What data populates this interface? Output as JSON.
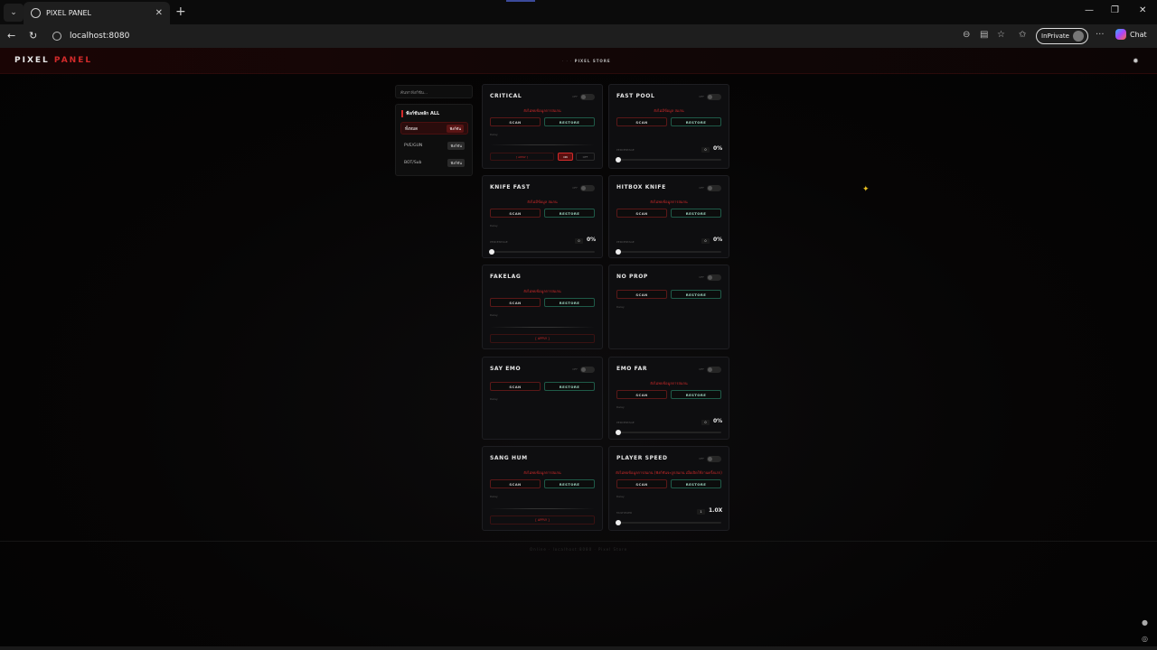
{
  "browser": {
    "tab_title": "PIXEL PANEL",
    "url": "localhost:8080",
    "inprivate_label": "InPrivate",
    "chat_label": "Chat"
  },
  "app": {
    "logo_a": "PIXEL",
    "logo_b": "PANEL",
    "breadcrumb_a": "· · ·",
    "breadcrumb_b": "PIXEL STORE",
    "search_placeholder": "ค้นหาฟังก์ชัน...",
    "footer": "Online   ·   localhost:8080   ·   Pixel Store"
  },
  "sidebar": {
    "title": "ฟังก์ชันหลัก ALL",
    "items": [
      {
        "label": "ทั้งหมด",
        "badge": "ฟังก์ชัน",
        "active": true
      },
      {
        "label": "PVE/GUN",
        "badge": "ฟังก์ชัน",
        "active": false
      },
      {
        "label": "BOT/Sub",
        "badge": "ฟังก์ชัน",
        "active": false
      }
    ]
  },
  "cards": [
    {
      "title": "CRITICAL",
      "status": "ยังไม่พบข้อมูลการสแกน",
      "scan": "SCAN",
      "restore": "RESTORE",
      "delay": "Delay",
      "apply": "[ APPLY ]",
      "on": "ON",
      "off": "OFF"
    },
    {
      "title": "FAST POOL",
      "status": "ยังไม่มีข้อมูล สแกน",
      "scan": "SCAN",
      "restore": "RESTORE",
      "slider_label": "PERCENTAGE",
      "value": "0",
      "display": "0%",
      "level": 0
    },
    {
      "title": "KNIFE FAST",
      "status": "ยังไม่มีข้อมูล สแกน",
      "scan": "SCAN",
      "restore": "RESTORE",
      "delay": "Delay",
      "slider_label": "PERCENTAGE",
      "value": "0",
      "display": "0%",
      "level": 0
    },
    {
      "title": "HITBOX KNIFE",
      "status": "ยังไม่พบข้อมูลการสแกน",
      "scan": "SCAN",
      "restore": "RESTORE",
      "slider_label": "PERCENTAGE",
      "value": "0",
      "display": "0%",
      "level": 0
    },
    {
      "title": "FAKELAG",
      "status": "ยังไม่พบข้อมูลการสแกน",
      "scan": "SCAN",
      "restore": "RESTORE",
      "delay": "Delay",
      "apply": "[ APPLY ]"
    },
    {
      "title": "NO PROP",
      "scan": "SCAN",
      "restore": "RESTORE",
      "delay": "Delay"
    },
    {
      "title": "SAY EMO",
      "scan": "SCAN",
      "restore": "RESTORE",
      "delay": "Delay"
    },
    {
      "title": "EMO FAR",
      "status": "ยังไม่พบข้อมูลการสแกน",
      "scan": "SCAN",
      "restore": "RESTORE",
      "delay": "Delay",
      "slider_label": "PERCENTAGE",
      "value": "0",
      "display": "0%",
      "level": 0
    },
    {
      "title": "SANG HUM",
      "status": "ยังไม่พบข้อมูลการสแกน",
      "scan": "SCAN",
      "restore": "RESTORE",
      "delay": "Delay",
      "apply": "[ APPLY ]"
    },
    {
      "title": "PLAYER SPEED",
      "status": "ยังไม่พบข้อมูลการสแกน (ฟังก์ชันจะถูกสแกน เมื่อเปิดใช้งานครั้งแรก)",
      "scan": "SCAN",
      "restore": "RESTORE",
      "delay": "Delay",
      "slider_label": "MULTIPLIER",
      "value": "1",
      "display": "1.0X",
      "level": 0
    }
  ],
  "toggle_label": "OFF"
}
